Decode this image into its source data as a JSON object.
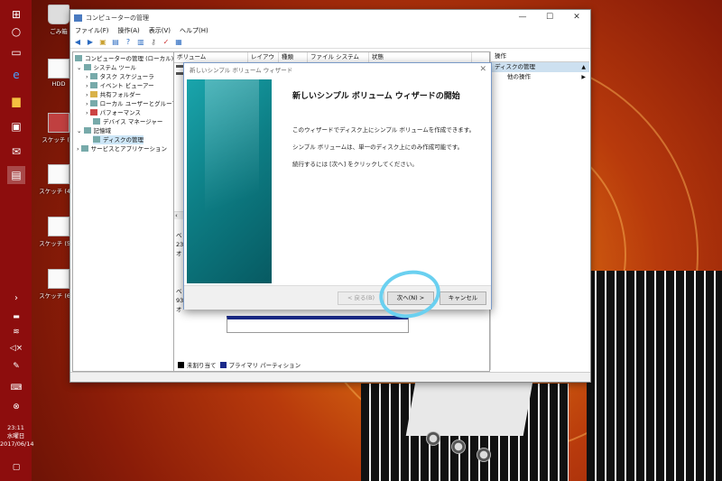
{
  "taskbar": {
    "time": "23:11",
    "weekday": "水曜日",
    "date": "2017/06/14"
  },
  "desktop_icons": [
    {
      "label": "ごみ箱"
    },
    {
      "label": "HDD"
    },
    {
      "label": "スケッチ (3)"
    },
    {
      "label": "スケッチ (4).g"
    },
    {
      "label": "スケッチ (5).g"
    },
    {
      "label": "スケッチ (6).g"
    }
  ],
  "window": {
    "title": "コンピューターの管理",
    "menu": [
      "ファイル(F)",
      "操作(A)",
      "表示(V)",
      "ヘルプ(H)"
    ],
    "tree": [
      {
        "label": "コンピューターの管理 (ローカル)"
      },
      {
        "label": "システム ツール"
      },
      {
        "label": "タスク スケジューラ"
      },
      {
        "label": "イベント ビューアー"
      },
      {
        "label": "共有フォルダー"
      },
      {
        "label": "ローカル ユーザーとグループ"
      },
      {
        "label": "パフォーマンス"
      },
      {
        "label": "デバイス マネージャー"
      },
      {
        "label": "記憶域"
      },
      {
        "label": "ディスクの管理"
      },
      {
        "label": "サービスとアプリケーション"
      }
    ],
    "columns": [
      "ボリューム",
      "レイアウト",
      "種類",
      "ファイル システム",
      "状態"
    ],
    "disk_rows": [
      {
        "a": "ベ",
        "b": "23",
        "c": "オ"
      },
      {
        "a": "ベ",
        "b": "93",
        "c": "オ"
      }
    ],
    "legend": [
      {
        "label": "未割り当て",
        "color": "#000000"
      },
      {
        "label": "プライマリ パーティション",
        "color": "#1a2a8a"
      }
    ],
    "actions": {
      "header": "操作",
      "selected": "ディスクの管理",
      "more": "他の操作"
    }
  },
  "wizard": {
    "title": "新しいシンプル ボリューム ウィザード",
    "heading": "新しいシンプル ボリューム ウィザードの開始",
    "lines": [
      "このウィザードでディスク上にシンプル ボリュームを作成できます。",
      "シンプル ボリュームは、単一のディスク上にのみ作成可能です。",
      "続行するには [次へ] をクリックしてください。"
    ],
    "buttons": {
      "back": "< 戻る(B)",
      "next": "次へ(N) >",
      "cancel": "キャンセル"
    }
  },
  "colors": {
    "taskbar": "#8d0d0d",
    "highlight_circle": "#6ad0f0",
    "wizard_side": "#0d7f86"
  }
}
